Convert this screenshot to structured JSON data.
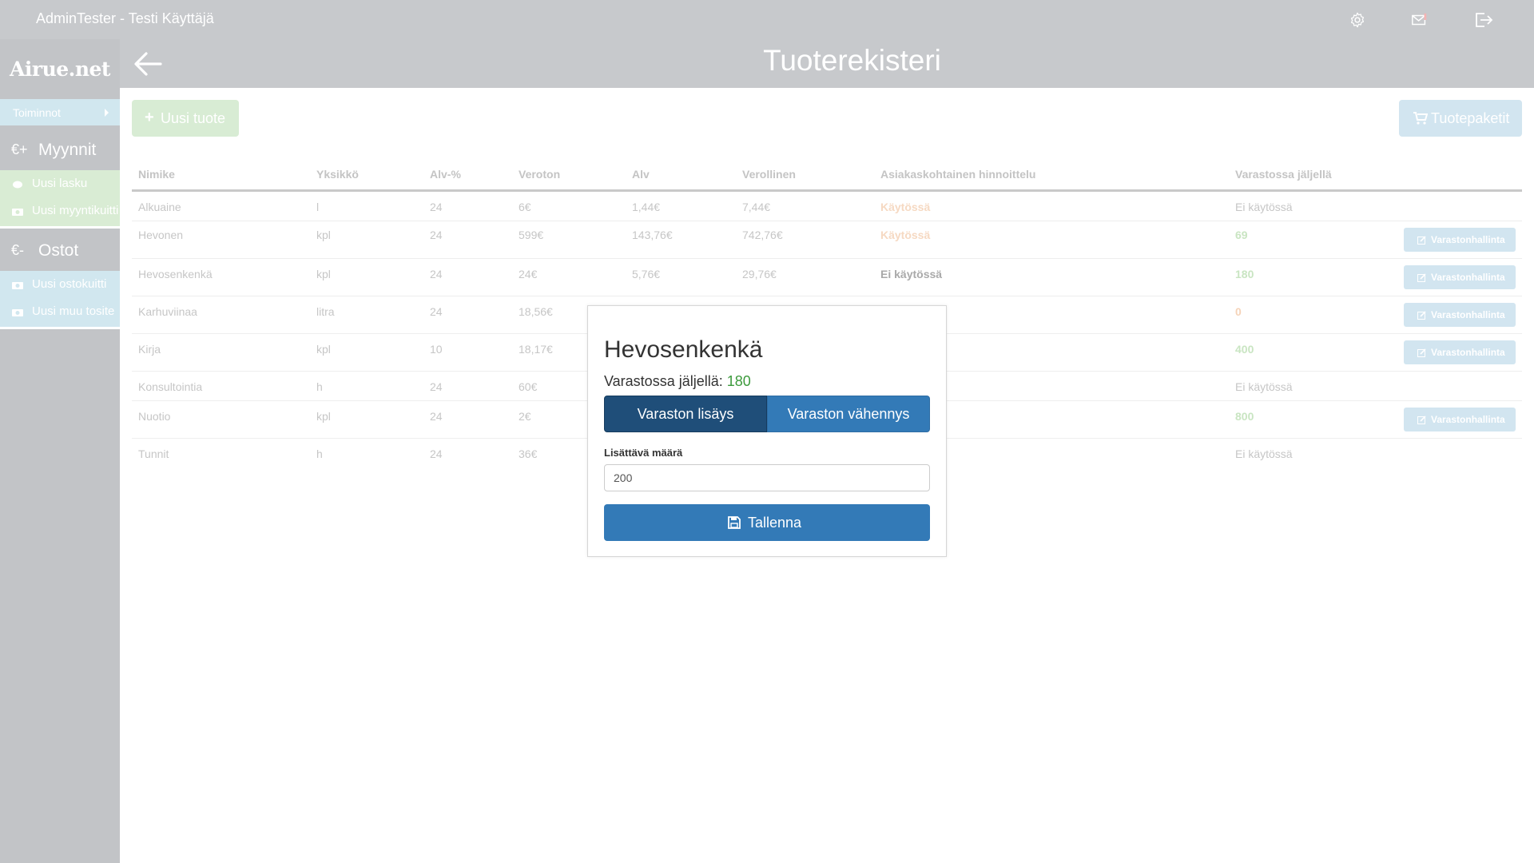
{
  "topbar": {
    "user": "AdminTester - Testi Käyttäjä"
  },
  "sidebar": {
    "logo": "Airue.net",
    "toiminnot": "Toiminnot",
    "sales": {
      "symbol": "€+",
      "label": "Myynnit",
      "items": [
        "Uusi lasku",
        "Uusi myyntikuitti"
      ]
    },
    "purchases": {
      "symbol": "€-",
      "label": "Ostot",
      "items": [
        "Uusi ostokuitti",
        "Uusi muu tosite"
      ]
    }
  },
  "header": {
    "title": "Tuoterekisteri"
  },
  "actions": {
    "new_product": "Uusi tuote",
    "packages": "Tuotepaketit"
  },
  "table": {
    "columns": [
      "Nimike",
      "Yksikkö",
      "Alv-%",
      "Veroton",
      "Alv",
      "Verollinen",
      "Asiakaskohtainen hinnoittelu",
      "Varastossa jäljellä"
    ],
    "manage_label": "Varastonhallinta",
    "rows": [
      {
        "name": "Alkuaine",
        "unit": "l",
        "vat": "24",
        "net": "6€",
        "tax": "1,44€",
        "gross": "7,44€",
        "pricing": "Käytössä",
        "stock": "Ei käytössä"
      },
      {
        "name": "Hevonen",
        "unit": "kpl",
        "vat": "24",
        "net": "599€",
        "tax": "143,76€",
        "gross": "742,76€",
        "pricing": "Käytössä",
        "stock": "69"
      },
      {
        "name": "Hevosenkenkä",
        "unit": "kpl",
        "vat": "24",
        "net": "24€",
        "tax": "5,76€",
        "gross": "29,76€",
        "pricing": "Ei käytössä",
        "stock": "180"
      },
      {
        "name": "Karhuviinaa",
        "unit": "litra",
        "vat": "24",
        "net": "18,56€",
        "stock": "0"
      },
      {
        "name": "Kirja",
        "unit": "kpl",
        "vat": "10",
        "net": "18,17€",
        "stock": "400"
      },
      {
        "name": "Konsultointia",
        "unit": "h",
        "vat": "24",
        "net": "60€",
        "stock": "Ei käytössä"
      },
      {
        "name": "Nuotio",
        "unit": "kpl",
        "vat": "24",
        "net": "2€",
        "stock": "800"
      },
      {
        "name": "Tunnit",
        "unit": "h",
        "vat": "24",
        "net": "36€",
        "stock": "Ei käytössä"
      }
    ]
  },
  "modal": {
    "title": "Hevosenkenkä",
    "stock_label": "Varastossa jäljellä:",
    "stock_value": "180",
    "add_tab": "Varaston lisäys",
    "sub_tab": "Varaston vähennys",
    "amount_label": "Lisättävä määrä",
    "amount_value": "200",
    "save": "Tallenna"
  }
}
